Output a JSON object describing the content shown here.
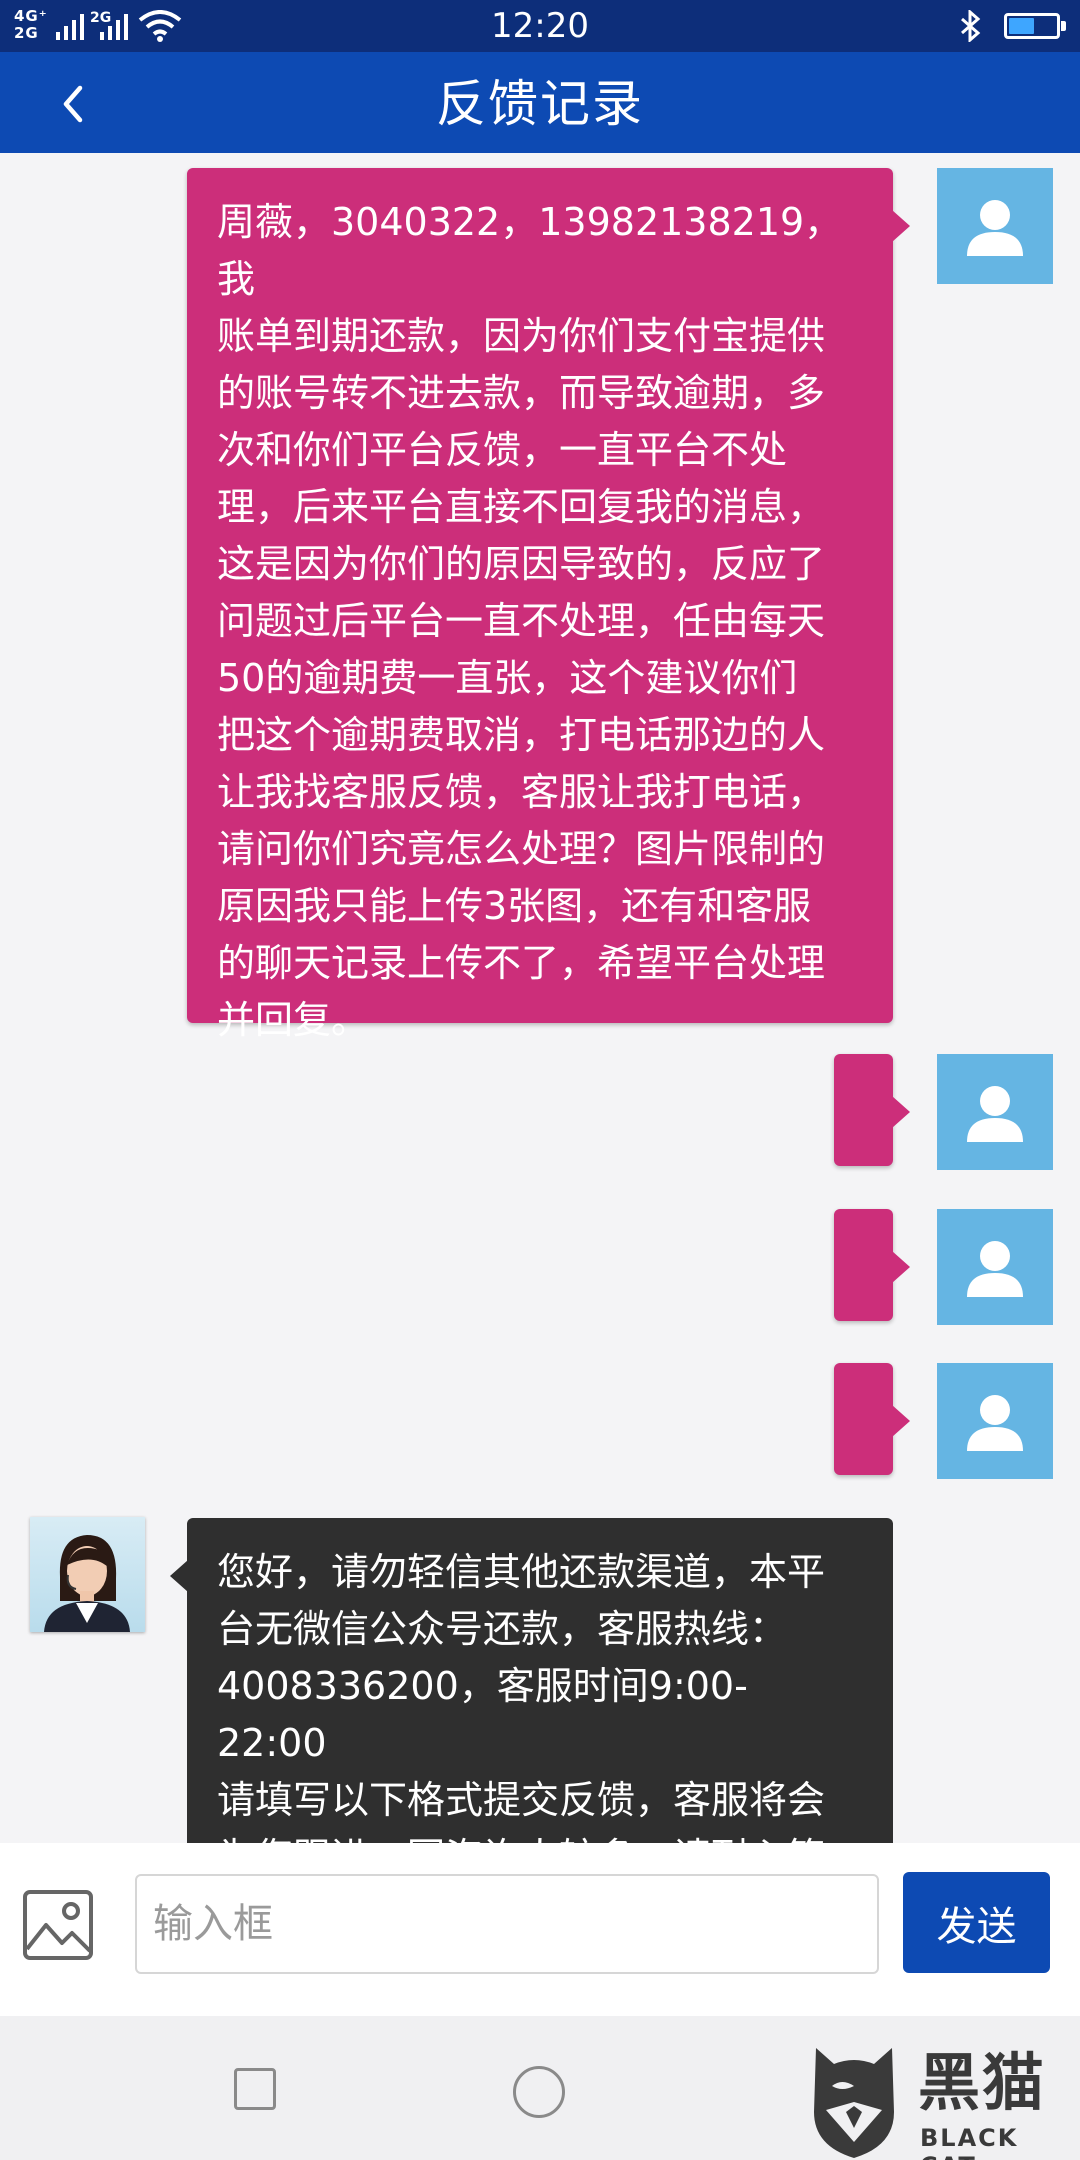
{
  "status_bar": {
    "time": "12:20",
    "network_label_top": "4G⁺",
    "network_label_bottom": "2G",
    "network2_label": "2G",
    "battery_level": 0.55,
    "battery_color": "#3ea6ff"
  },
  "nav": {
    "title": "反馈记录",
    "back_icon": "chevron-left-icon"
  },
  "messages": [
    {
      "from": "user",
      "text": "周薇，3040322，13982138219，我\n账单到期还款，因为你们支付宝提供\n的账号转不进去款，而导致逾期，多\n次和你们平台反馈，一直平台不处\n理，后来平台直接不回复我的消息，\n这是因为你们的原因导致的，反应了\n问题过后平台一直不处理，任由每天\n50的逾期费一直张，这个建议你们\n把这个逾期费取消，打电话那边的人\n让我找客服反馈，客服让我打电话，\n请问你们究竟怎么处理？图片限制的\n原因我只能上传3张图，还有和客服\n的聊天记录上传不了，希望平台处理\n并回复。"
    },
    {
      "from": "user",
      "text": ""
    },
    {
      "from": "user",
      "text": ""
    },
    {
      "from": "user",
      "text": ""
    },
    {
      "from": "agent",
      "text": "您好，请勿轻信其他还款渠道，本平\n台无微信公众号还款，客服热线：\n4008336200，客服时间9:00-22:00\n请填写以下格式提交反馈，客服将会\n为您跟进，因咨询人较多，请耐心等\n待。借款姓名：　身份证　借款手"
    }
  ],
  "input": {
    "placeholder": "输入框",
    "value": "",
    "send_label": "发送"
  },
  "watermark": {
    "main_text": "黑猫",
    "sub_text": "BLACK CAT"
  },
  "colors": {
    "status_bar": "#0d2e7a",
    "nav_bar": "#0d4ab3",
    "user_bubble": "#cc2e7a",
    "agent_bubble": "#2f2f2f",
    "user_avatar": "#65b5e3",
    "send_button": "#0d4ab3"
  }
}
